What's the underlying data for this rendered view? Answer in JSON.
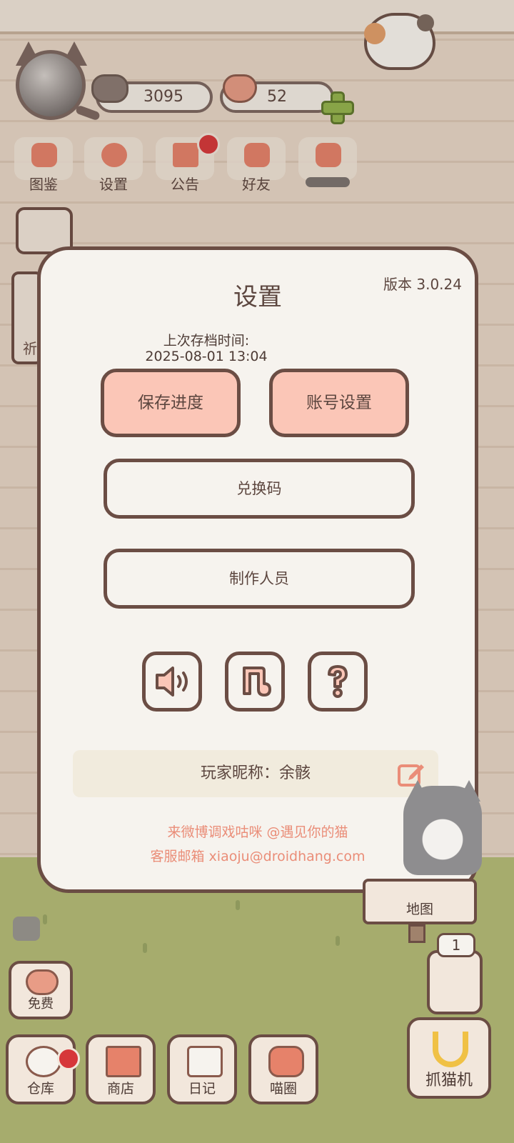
{
  "hud": {
    "fish_count": "3095",
    "heart_count": "52"
  },
  "top_menu": [
    {
      "label": "图鉴"
    },
    {
      "label": "设置"
    },
    {
      "label": "公告"
    },
    {
      "label": "好友"
    }
  ],
  "side": {
    "card_char": "祈"
  },
  "settings": {
    "title": "设置",
    "version": "版本 3.0.24",
    "last_save_label": "上次存档时间:",
    "last_save_time": "2025-08-01 13:04",
    "save_button": "保存进度",
    "account_button": "账号设置",
    "redeem_button": "兑换码",
    "credits_button": "制作人员",
    "nickname_label": "玩家昵称：余骸",
    "weibo_line": "来微博调戏咕咪 @遇见你的猫",
    "email_line": "客服邮箱 xiaoju@droidhang.com"
  },
  "map": {
    "label": "地图"
  },
  "claw": {
    "counter": "1",
    "label": "抓猫机"
  },
  "free": {
    "label": "免费"
  },
  "bottom_nav": [
    {
      "label": "仓库"
    },
    {
      "label": "商店"
    },
    {
      "label": "日记"
    },
    {
      "label": "喵圈"
    }
  ],
  "colors": {
    "accent_pink": "#fbc6b7",
    "border_brown": "#6b4d44",
    "link_orange": "#ea8d78",
    "badge_red": "#d6373a"
  }
}
